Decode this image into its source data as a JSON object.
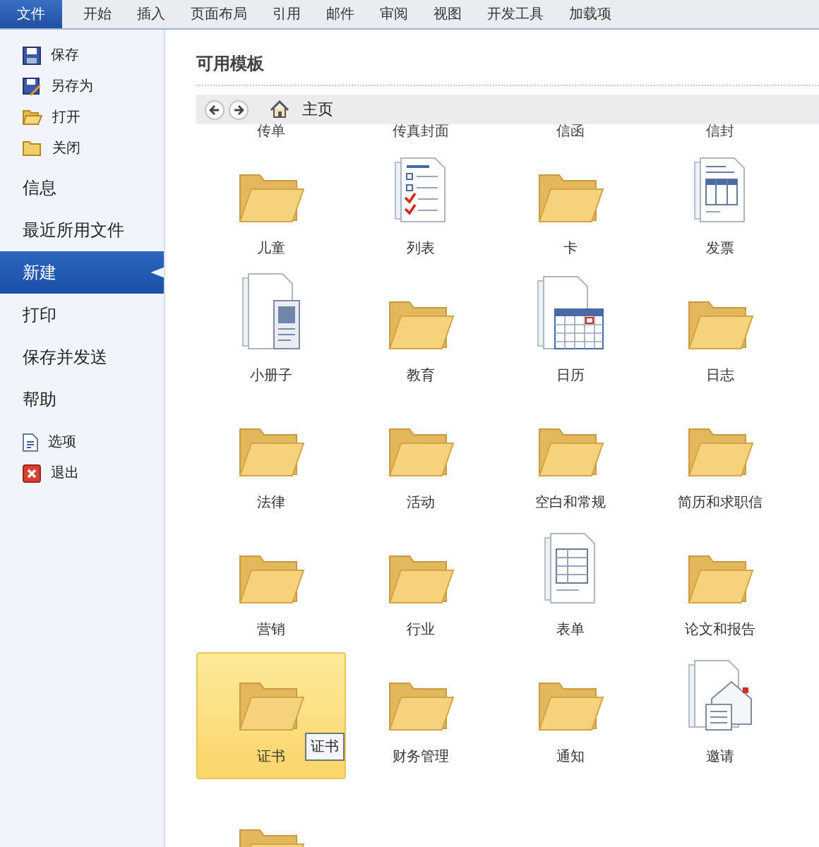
{
  "ribbon": {
    "tabs": [
      {
        "label": "文件",
        "selected": true
      },
      {
        "label": "开始",
        "selected": false
      },
      {
        "label": "插入",
        "selected": false
      },
      {
        "label": "页面布局",
        "selected": false
      },
      {
        "label": "引用",
        "selected": false
      },
      {
        "label": "邮件",
        "selected": false
      },
      {
        "label": "审阅",
        "selected": false
      },
      {
        "label": "视图",
        "selected": false
      },
      {
        "label": "开发工具",
        "selected": false
      },
      {
        "label": "加载项",
        "selected": false
      }
    ]
  },
  "sidebar": {
    "items": [
      {
        "kind": "save",
        "label": "保存",
        "selected": false
      },
      {
        "kind": "saveas",
        "label": "另存为",
        "selected": false
      },
      {
        "kind": "open",
        "label": "打开",
        "selected": false
      },
      {
        "kind": "close",
        "label": "关闭",
        "selected": false
      },
      {
        "kind": "section",
        "label": "信息",
        "selected": false
      },
      {
        "kind": "section",
        "label": "最近所用文件",
        "selected": false
      },
      {
        "kind": "section",
        "label": "新建",
        "selected": true
      },
      {
        "kind": "section",
        "label": "打印",
        "selected": false
      },
      {
        "kind": "section",
        "label": "保存并发送",
        "selected": false
      },
      {
        "kind": "section",
        "label": "帮助",
        "selected": false
      },
      {
        "kind": "options",
        "label": "选项",
        "selected": false
      },
      {
        "kind": "exit",
        "label": "退出",
        "selected": false
      }
    ]
  },
  "templates": {
    "title": "可用模板",
    "breadcrumb": "主页",
    "cut_labels": [
      "传单",
      "传真封面",
      "信函",
      "信封"
    ],
    "items": [
      {
        "kind": "folder",
        "label": "儿童",
        "selected": false
      },
      {
        "kind": "list",
        "label": "列表",
        "selected": false
      },
      {
        "kind": "folder",
        "label": "卡",
        "selected": false
      },
      {
        "kind": "invoice",
        "label": "发票",
        "selected": false
      },
      {
        "kind": "booklet",
        "label": "小册子",
        "selected": false
      },
      {
        "kind": "folder",
        "label": "教育",
        "selected": false
      },
      {
        "kind": "calendar",
        "label": "日历",
        "selected": false
      },
      {
        "kind": "folder",
        "label": "日志",
        "selected": false
      },
      {
        "kind": "folder",
        "label": "法律",
        "selected": false
      },
      {
        "kind": "folder",
        "label": "活动",
        "selected": false
      },
      {
        "kind": "folder",
        "label": "空白和常规",
        "selected": false
      },
      {
        "kind": "folder",
        "label": "简历和求职信",
        "selected": false
      },
      {
        "kind": "folder",
        "label": "营销",
        "selected": false
      },
      {
        "kind": "folder",
        "label": "行业",
        "selected": false
      },
      {
        "kind": "form",
        "label": "表单",
        "selected": false
      },
      {
        "kind": "folder",
        "label": "论文和报告",
        "selected": false
      },
      {
        "kind": "folder",
        "label": "证书",
        "selected": true,
        "tooltip": "证书"
      },
      {
        "kind": "folder",
        "label": "财务管理",
        "selected": false
      },
      {
        "kind": "folder",
        "label": "通知",
        "selected": false
      },
      {
        "kind": "invitation",
        "label": "邀请",
        "selected": false
      },
      {
        "kind": "folder",
        "selected": false
      }
    ]
  }
}
